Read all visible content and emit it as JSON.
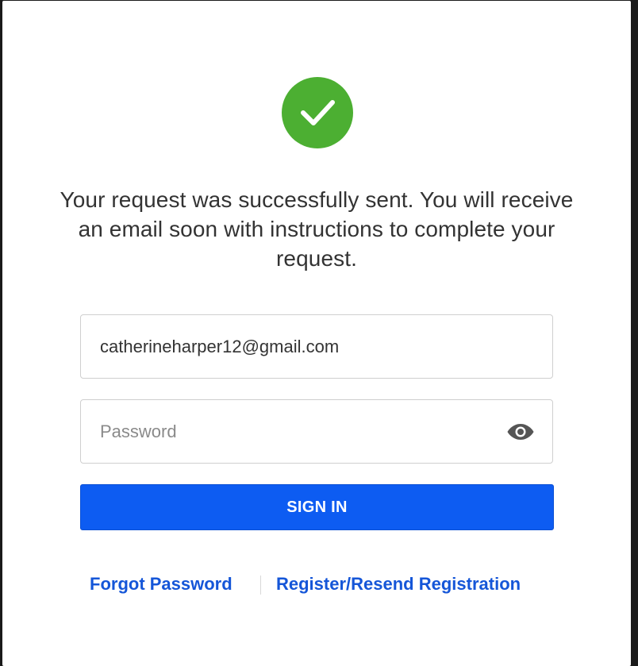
{
  "success": {
    "icon": "checkmark-circle-icon",
    "icon_color": "#4caf32",
    "message": "Your request was successfully sent. You will receive an email soon with instructions to complete your request."
  },
  "form": {
    "email_value": "catherineharper12@gmail.com",
    "password_placeholder": "Password",
    "password_value": "",
    "eye_icon": "eye-icon",
    "sign_in_label": "SIGN IN",
    "accent_color": "#0d5cf2"
  },
  "links": {
    "forgot_password": "Forgot Password",
    "register": "Register/Resend Registration",
    "link_color": "#1556d8"
  }
}
